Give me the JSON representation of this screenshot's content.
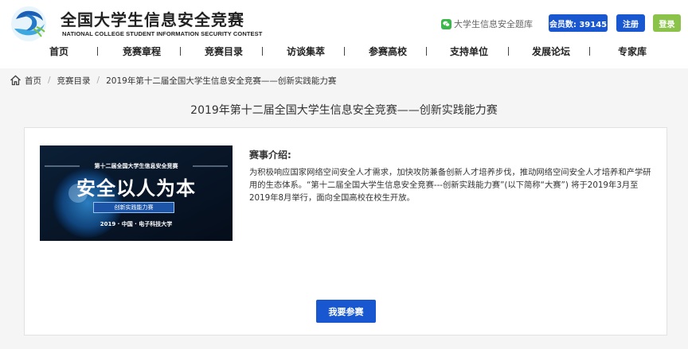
{
  "site": {
    "title": "全国大学生信息安全竞赛",
    "subtitle": "NATIONAL COLLEGE STUDENT INFORMATION SECURITY CONTEST"
  },
  "top_bar": {
    "question_bank": "大学生信息安全题库",
    "members": "会员数: 39145",
    "register": "注册",
    "login": "登录"
  },
  "nav": {
    "items": [
      "首页",
      "竞赛章程",
      "竞赛目录",
      "访谈集萃",
      "参赛高校",
      "支持单位",
      "发展论坛",
      "专家库"
    ]
  },
  "breadcrumb": {
    "home": "首页",
    "catalog": "竞赛目录",
    "current": "2019年第十二届全国大学生信息安全竞赛——创新实践能力赛"
  },
  "page_title": "2019年第十二届全国大学生信息安全竞赛——创新实践能力赛",
  "banner": {
    "headline": "第十二届全国大学生信息安全竞赛",
    "slogan": "安全以人为本",
    "tag": "创新实践能力赛",
    "footer": "2019 · 中国 · 电子科技大学"
  },
  "intro": {
    "title": "赛事介绍:",
    "text": "为积极响应国家网络空间安全人才需求，加快攻防兼备创新人才培养步伐，推动网络空间安全人才培养和产学研用的生态体系。“第十二届全国大学生信息安全竞赛---创新实践能力赛”(以下简称“大赛”) 将于2019年3月至2019年8月举行，面向全国高校在校生开放。"
  },
  "join_button": "我要参赛",
  "colors": {
    "primary": "#1957d1",
    "login": "#8bc34a",
    "wechat": "#3bb84a"
  }
}
